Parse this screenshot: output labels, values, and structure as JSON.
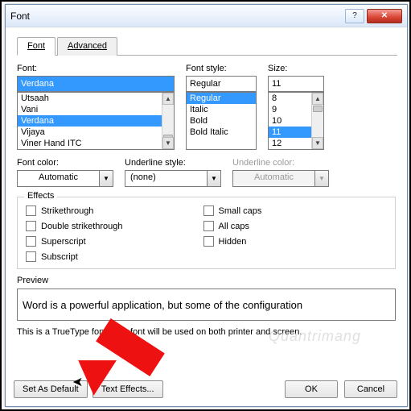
{
  "window": {
    "title": "Font"
  },
  "tabs": {
    "font": "Font",
    "advanced": "Advanced"
  },
  "font_section": {
    "label": "Font:",
    "value": "Verdana",
    "options": [
      "Utsaah",
      "Vani",
      "Verdana",
      "Vijaya",
      "Viner Hand ITC"
    ]
  },
  "style_section": {
    "label": "Font style:",
    "value": "Regular",
    "options": [
      "Regular",
      "Italic",
      "Bold",
      "Bold Italic"
    ]
  },
  "size_section": {
    "label": "Size:",
    "value": "11",
    "options": [
      "8",
      "9",
      "10",
      "11",
      "12"
    ]
  },
  "font_color": {
    "label": "Font color:",
    "value": "Automatic"
  },
  "underline_style": {
    "label": "Underline style:",
    "value": "(none)"
  },
  "underline_color": {
    "label": "Underline color:",
    "value": "Automatic"
  },
  "effects": {
    "title": "Effects",
    "strike": "Strikethrough",
    "dstrike": "Double strikethrough",
    "superscript": "Superscript",
    "subscript": "Subscript",
    "smallcaps": "Small caps",
    "allcaps": "All caps",
    "hidden": "Hidden"
  },
  "preview": {
    "label": "Preview",
    "text": "Word is a powerful application, but some of the configuration",
    "note": "This is a TrueType font. This font will be used on both printer and screen."
  },
  "buttons": {
    "default": "Set As Default",
    "text_effects": "Text Effects...",
    "ok": "OK",
    "cancel": "Cancel"
  },
  "watermark": "Quantrimang"
}
